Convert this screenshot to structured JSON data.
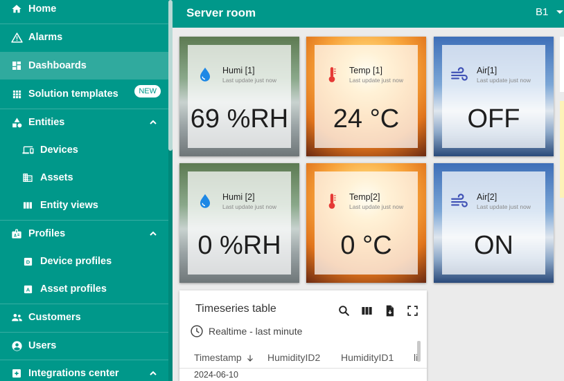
{
  "sidebar": {
    "items": [
      {
        "label": "Home",
        "icon": "home-icon"
      },
      {
        "label": "Alarms",
        "icon": "warning-icon"
      },
      {
        "label": "Dashboards",
        "icon": "dashboard-icon",
        "active": true
      },
      {
        "label": "Solution templates",
        "icon": "grid-icon",
        "badge": "NEW"
      },
      {
        "label": "Entities",
        "icon": "shapes-icon",
        "expanded": true
      },
      {
        "label": "Devices",
        "icon": "devices-icon"
      },
      {
        "label": "Assets",
        "icon": "domain-icon"
      },
      {
        "label": "Entity views",
        "icon": "view-column-icon"
      },
      {
        "label": "Profiles",
        "icon": "badge-icon",
        "expanded": true
      },
      {
        "label": "Device profiles",
        "icon": "device-profile-icon"
      },
      {
        "label": "Asset profiles",
        "icon": "asset-profile-icon"
      },
      {
        "label": "Customers",
        "icon": "people-icon"
      },
      {
        "label": "Users",
        "icon": "account-icon"
      },
      {
        "label": "Integrations center",
        "icon": "integrations-icon",
        "expanded": true
      }
    ]
  },
  "topbar": {
    "title": "Server room",
    "state": "B1"
  },
  "tiles": [
    {
      "name": "Humi [1]",
      "updated": "Last update just now",
      "value": "69 %RH",
      "kind": "humidity"
    },
    {
      "name": "Temp [1]",
      "updated": "Last update just now",
      "value": "24 °C",
      "kind": "temperature"
    },
    {
      "name": "Air[1]",
      "updated": "Last update just now",
      "value": "OFF",
      "kind": "air"
    },
    {
      "name": "Humi [2]",
      "updated": "Last update just now",
      "value": "0 %RH",
      "kind": "humidity"
    },
    {
      "name": "Temp[2]",
      "updated": "Last update just now",
      "value": "0 °C",
      "kind": "temperature"
    },
    {
      "name": "Air[2]",
      "updated": "Last update just now",
      "value": "ON",
      "kind": "air"
    }
  ],
  "table": {
    "title": "Timeseries table",
    "timewindow": "Realtime - last minute",
    "columns": [
      "Timestamp",
      "HumidityID2",
      "HumidityID1",
      "li"
    ],
    "sort_column": "Timestamp",
    "first_row_timestamp": "2024-06-10",
    "tool_icons": [
      "search-icon",
      "columns-icon",
      "export-icon",
      "fullscreen-icon"
    ]
  },
  "colors": {
    "primary": "#00988a",
    "active_nav": "#30aa9e",
    "humidity_icon": "#1e88e5",
    "temperature_icon": "#e53935",
    "air_icon": "#3f51b5"
  }
}
